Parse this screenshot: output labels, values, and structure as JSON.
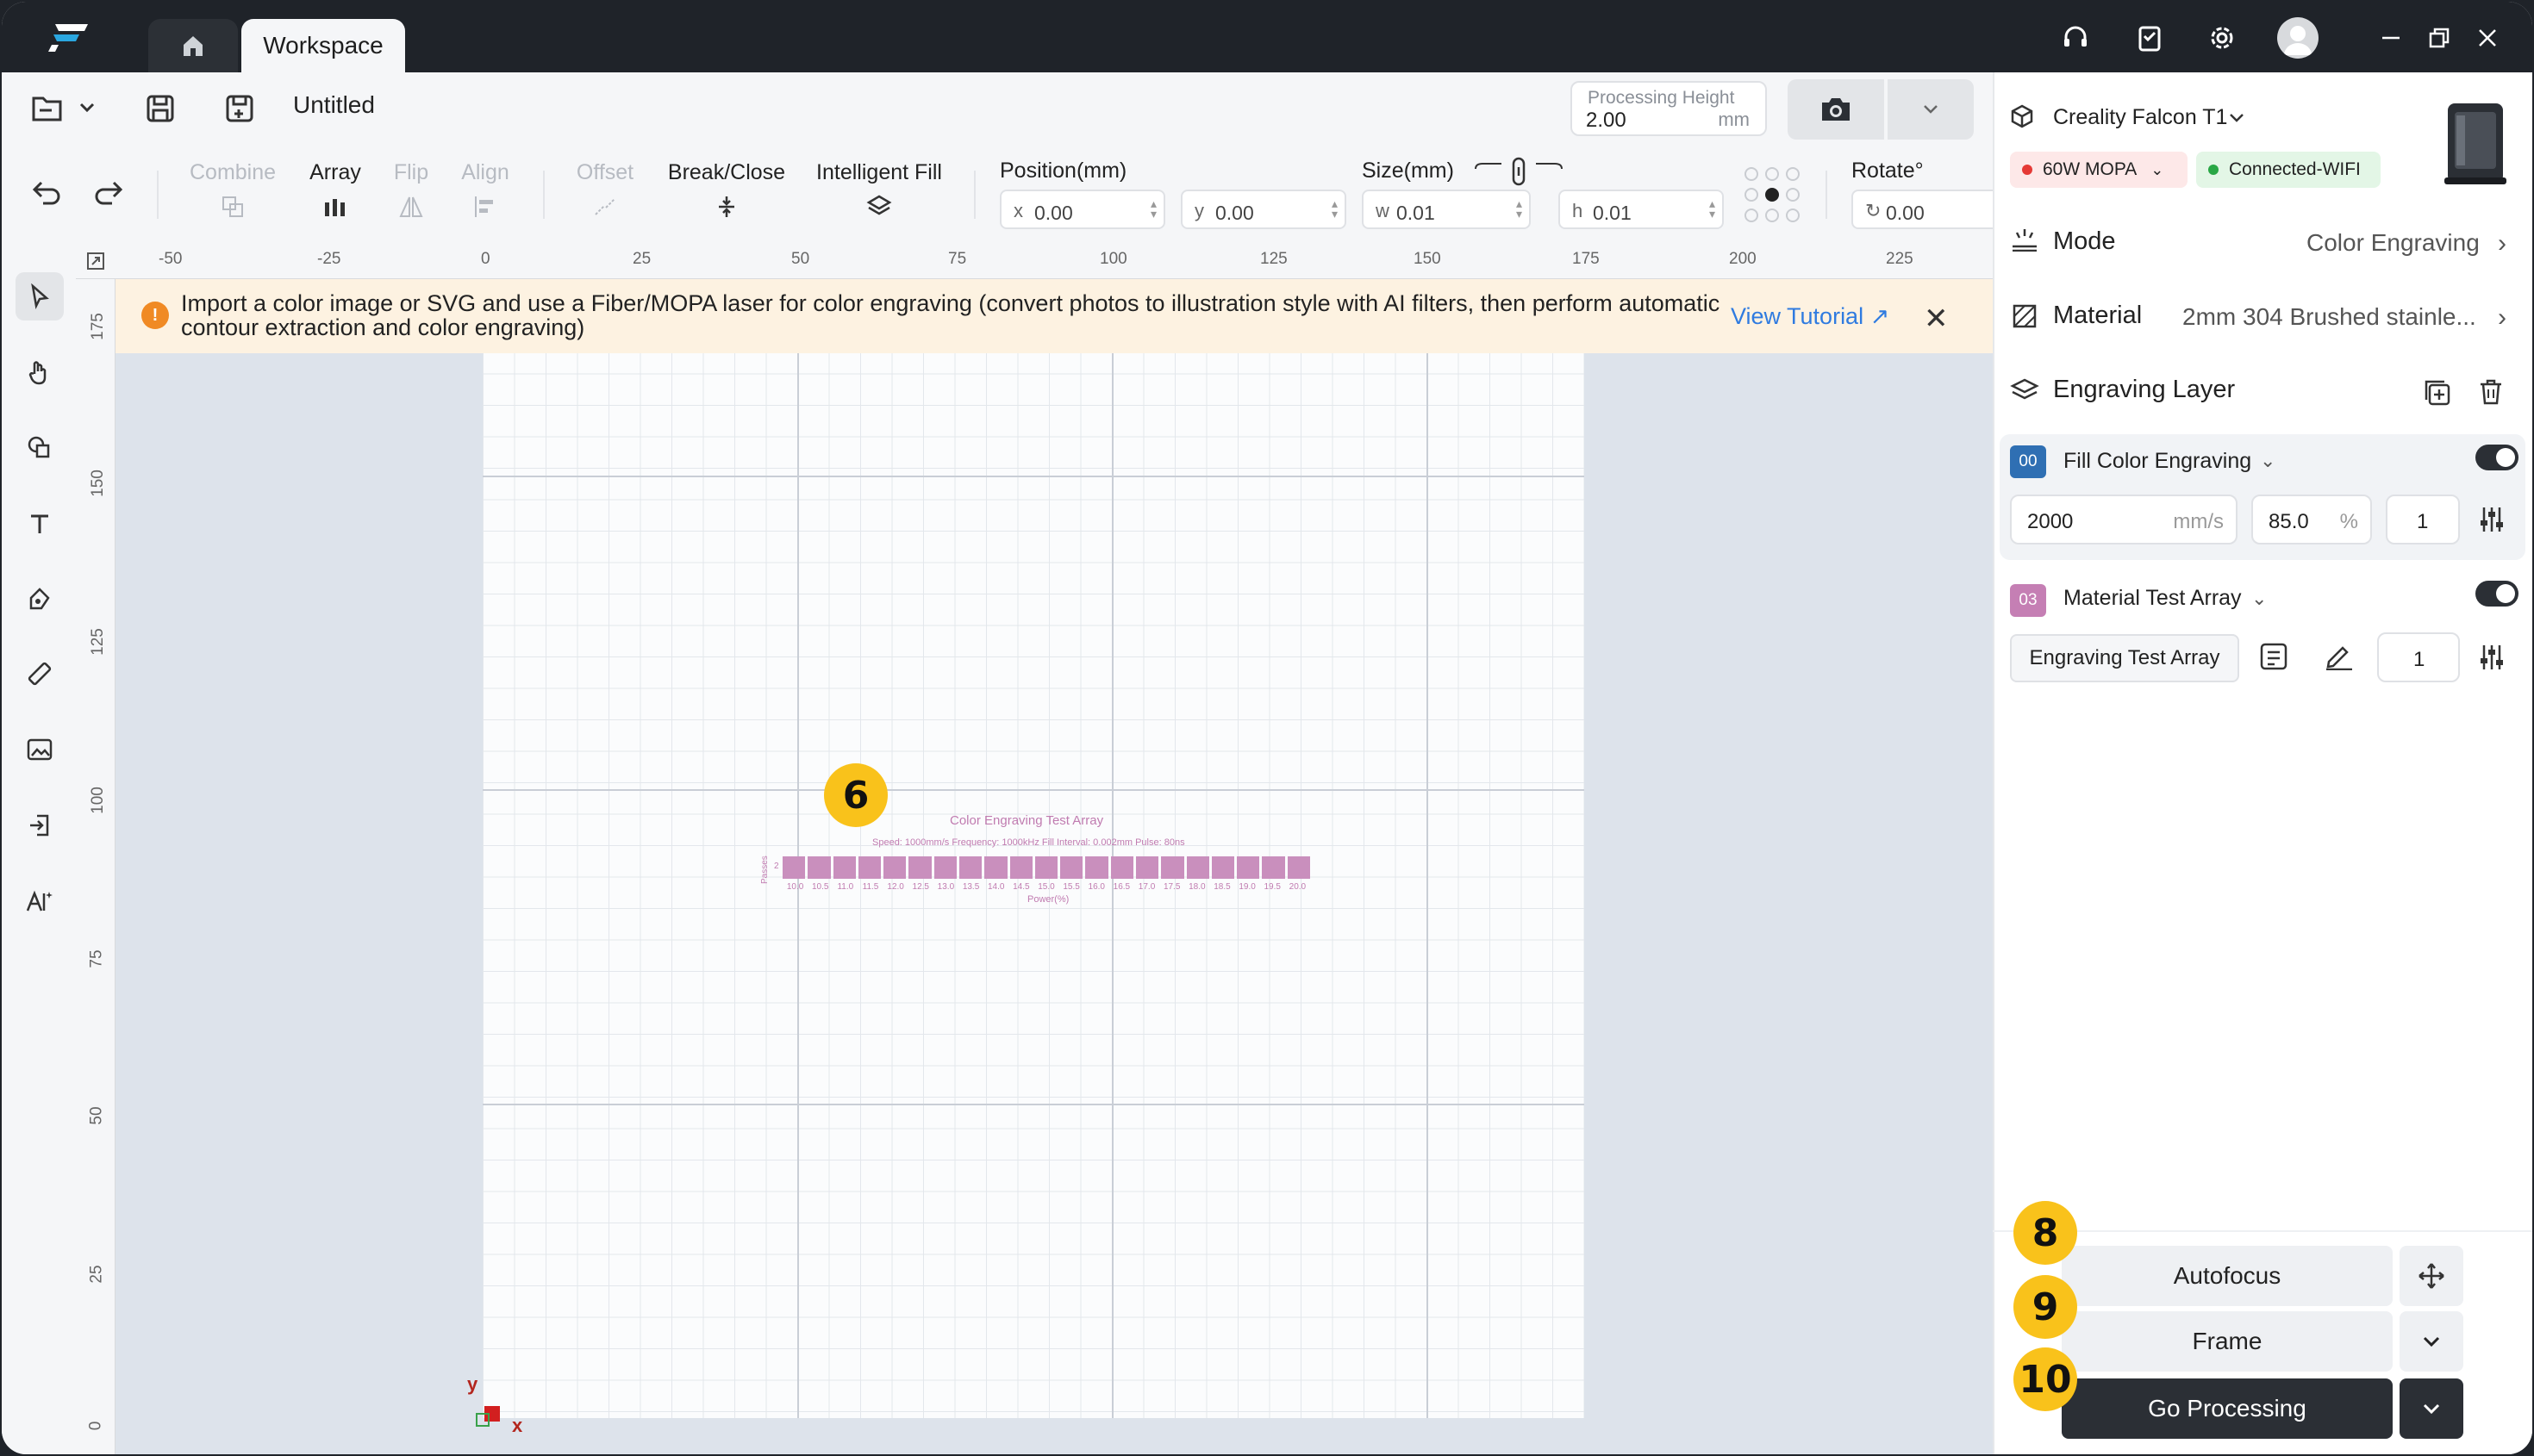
{
  "titlebar": {
    "tab_workspace": "Workspace"
  },
  "filebar": {
    "doc_title": "Untitled",
    "processing_height_label": "Processing Height",
    "processing_height_value": "2.00",
    "processing_height_unit": "mm"
  },
  "toolbar": {
    "combine": "Combine",
    "array": "Array",
    "flip": "Flip",
    "align": "Align",
    "offset": "Offset",
    "break_close": "Break/Close",
    "intelligent_fill": "Intelligent Fill",
    "position_label": "Position(mm)",
    "x_prefix": "x",
    "x_value": "0.00",
    "y_prefix": "y",
    "y_value": "0.00",
    "size_label": "Size(mm)",
    "w_prefix": "w",
    "w_value": "0.01",
    "h_prefix": "h",
    "h_value": "0.01",
    "rotate_label": "Rotate°",
    "rotate_value": "0.00"
  },
  "ruler": {
    "top_ticks": [
      "-50",
      "-25",
      "0",
      "25",
      "50",
      "75",
      "100",
      "125",
      "150",
      "175",
      "200",
      "225"
    ],
    "left_ticks": [
      "175",
      "150",
      "125",
      "100",
      "75",
      "50",
      "25",
      "0"
    ]
  },
  "banner": {
    "message": "Import a color image or SVG and use a Fiber/MOPA laser for color engraving (convert photos to illustration style with AI filters, then perform automatic contour extraction and color engraving)",
    "tutorial_link": "View Tutorial"
  },
  "test_array": {
    "title": "Color Engraving Test Array",
    "subtitle": "Speed: 1000mm/s   Frequency: 1000kHz   Fill Interval: 0.002mm   Pulse: 80ns",
    "passes_label": "Passes",
    "pass_value": "2",
    "power_values": [
      "10.0",
      "10.5",
      "11.0",
      "11.5",
      "12.0",
      "12.5",
      "13.0",
      "13.5",
      "14.0",
      "14.5",
      "15.0",
      "15.5",
      "16.0",
      "16.5",
      "17.0",
      "17.5",
      "18.0",
      "18.5",
      "19.0",
      "19.5",
      "20.0"
    ],
    "power_axis_label": "Power(%)"
  },
  "origin": {
    "y_label": "y",
    "x_label": "x"
  },
  "badges": {
    "b6": "6",
    "b8": "8",
    "b9": "9",
    "b10": "10"
  },
  "right_panel": {
    "device_name": "Creality Falcon T1",
    "laser_chip": "60W MOPA",
    "connection_chip": "Connected-WIFI",
    "mode_label": "Mode",
    "mode_value": "Color Engraving",
    "material_label": "Material",
    "material_value": "2mm 304 Brushed stainle...",
    "engraving_layer_label": "Engraving Layer",
    "layers": [
      {
        "index": "00",
        "name": "Fill Color Engraving",
        "speed": "2000",
        "speed_unit": "mm/s",
        "power": "85.0",
        "power_unit": "%",
        "passes": "1",
        "color": "#2f6fb3"
      },
      {
        "index": "03",
        "name": "Material Test Array",
        "button": "Engraving Test Array",
        "passes": "1",
        "color": "#c57fb4"
      }
    ],
    "autofocus": "Autofocus",
    "frame": "Frame",
    "go_processing": "Go Processing"
  }
}
